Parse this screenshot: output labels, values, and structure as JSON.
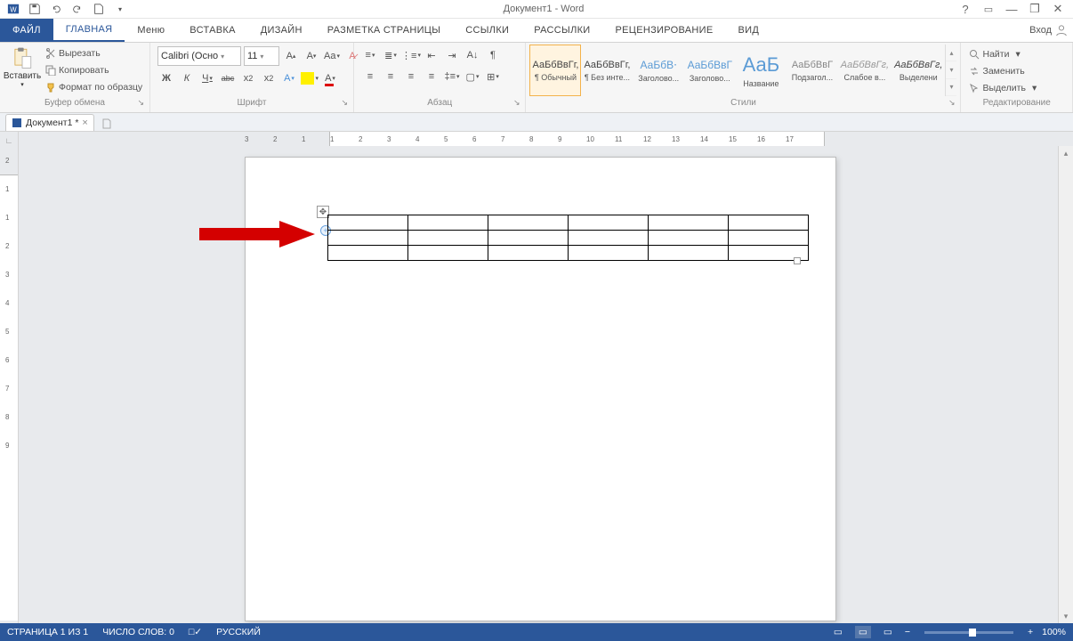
{
  "app_title": "Документ1 - Word",
  "qat": {
    "save": "save",
    "undo": "undo",
    "redo": "redo",
    "new": "new"
  },
  "win": {
    "help": "?",
    "opts": "⋯",
    "min": "—",
    "restore": "❐",
    "close": "✕"
  },
  "login_label": "Вход",
  "tabs": {
    "file": "ФАЙЛ",
    "home": "ГЛАВНАЯ",
    "menu": "Меню",
    "insert": "ВСТАВКА",
    "design": "ДИЗАЙН",
    "layout": "РАЗМЕТКА СТРАНИЦЫ",
    "refs": "ССЫЛКИ",
    "mail": "РАССЫЛКИ",
    "review": "РЕЦЕНЗИРОВАНИЕ",
    "view": "ВИД"
  },
  "clipboard": {
    "paste": "Вставить",
    "cut": "Вырезать",
    "copy": "Копировать",
    "format": "Формат по образцу",
    "group": "Буфер обмена"
  },
  "font": {
    "name": "Calibri (Осно",
    "size": "11",
    "group": "Шрифт"
  },
  "para": {
    "group": "Абзац"
  },
  "styles": {
    "group": "Стили",
    "items": [
      {
        "preview": "АаБбВвГг,",
        "label": "¶ Обычный"
      },
      {
        "preview": "АаБбВвГг,",
        "label": "¶ Без инте..."
      },
      {
        "preview": "АаБбВ⋅",
        "label": "Заголово..."
      },
      {
        "preview": "АаБбВвГ",
        "label": "Заголово..."
      },
      {
        "preview": "АаБ",
        "label": "Название"
      },
      {
        "preview": "АаБбВвГ",
        "label": "Подзагол..."
      },
      {
        "preview": "АаБбВвГг,",
        "label": "Слабое в..."
      },
      {
        "preview": "АаБбВвГг,",
        "label": "Выделени"
      }
    ]
  },
  "editing": {
    "find": "Найти",
    "replace": "Заменить",
    "select": "Выделить",
    "group": "Редактирование"
  },
  "doc_tab": "Документ1 *",
  "ruler_h": [
    3,
    2,
    1,
    1,
    2,
    3,
    4,
    5,
    6,
    7,
    8,
    9,
    10,
    11,
    12,
    13,
    14,
    15,
    16,
    17
  ],
  "ruler_v": [
    2,
    1,
    1,
    2,
    3,
    4,
    5,
    6,
    7,
    8,
    9
  ],
  "status": {
    "page": "СТРАНИЦА 1 ИЗ 1",
    "words": "ЧИСЛО СЛОВ: 0",
    "lang": "РУССКИЙ",
    "zoom": "100%",
    "minus": "−",
    "plus": "+"
  }
}
